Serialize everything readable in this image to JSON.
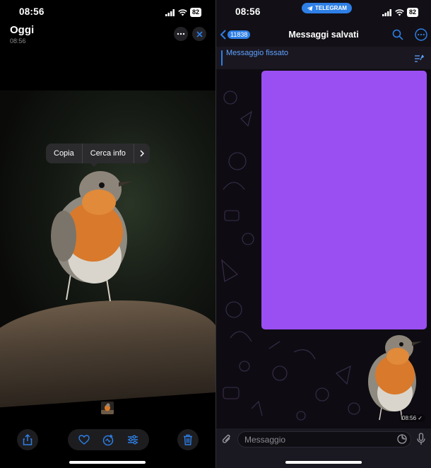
{
  "left": {
    "status": {
      "time": "08:56",
      "battery": "82"
    },
    "header": {
      "title": "Oggi",
      "subtitle": "08:56"
    },
    "context_menu": {
      "items": [
        "Copia",
        "Cerca info"
      ]
    }
  },
  "right": {
    "status": {
      "time": "08:56",
      "battery": "82",
      "app_pill": "TELEGRAM"
    },
    "header": {
      "back_count": "11838",
      "title": "Messaggi salvati"
    },
    "pinned": {
      "label": "Messaggio fissato"
    },
    "message": {
      "time": "08:56"
    },
    "input": {
      "placeholder": "Messaggio"
    }
  },
  "colors": {
    "accent": "#2e7fe6",
    "purple_block": "#9a4ff2"
  }
}
